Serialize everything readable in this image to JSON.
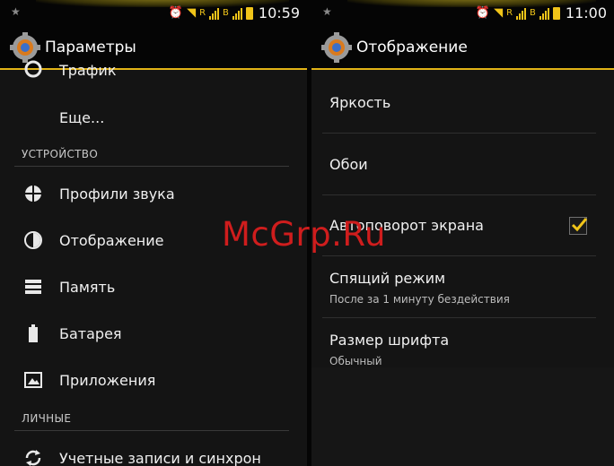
{
  "left": {
    "status": {
      "time": "10:59"
    },
    "title": "Параметры",
    "items_top": [
      {
        "label": "Трафик",
        "icon": "traffic-icon"
      },
      {
        "label": "Еще...",
        "icon": ""
      }
    ],
    "section_device": "УСТРОЙСТВО",
    "device_items": [
      {
        "label": "Профили звука",
        "icon": "sound-profile-icon"
      },
      {
        "label": "Отображение",
        "icon": "display-icon"
      },
      {
        "label": "Память",
        "icon": "storage-icon"
      },
      {
        "label": "Батарея",
        "icon": "battery-icon"
      },
      {
        "label": "Приложения",
        "icon": "apps-icon"
      }
    ],
    "section_personal": "ЛИЧНЫЕ",
    "personal_items": [
      {
        "label": "Учетные записи и синхрон",
        "icon": "sync-icon"
      }
    ]
  },
  "right": {
    "status": {
      "time": "11:00"
    },
    "title": "Отображение",
    "items": [
      {
        "title": "Яркость",
        "summary": ""
      },
      {
        "title": "Обои",
        "summary": ""
      },
      {
        "title": "Автоповорот экрана",
        "summary": "",
        "checked": true
      },
      {
        "title": "Спящий режим",
        "summary": "После за 1 минуту бездействия"
      },
      {
        "title": "Размер шрифта",
        "summary": "Обычный"
      }
    ]
  },
  "watermark": "McGrp.Ru",
  "colors": {
    "accent": "#e2b416",
    "background": "#141414",
    "watermark": "#cf1d1d"
  }
}
